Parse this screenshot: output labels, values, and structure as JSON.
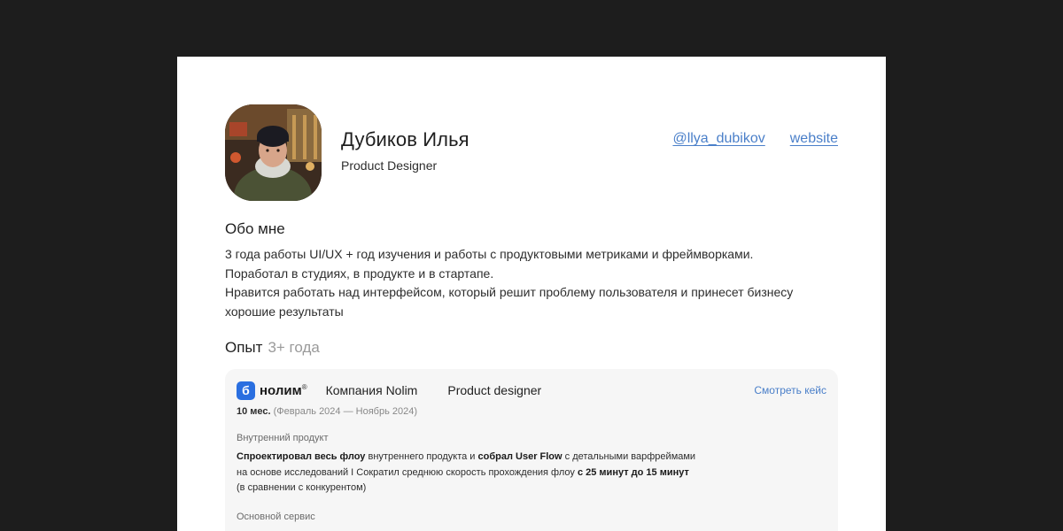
{
  "profile": {
    "name": "Дубиков Илья",
    "role": "Product Designer",
    "links": {
      "telegram": "@llya_dubikov",
      "website": "website"
    }
  },
  "about": {
    "title": "Обо мне",
    "lines": [
      "3 года работы UI/UX + год изучения и работы с продуктовыми метриками и фреймворками.",
      "Поработал в студиях, в продукте и в стартапе.",
      "Нравится работать над интерфейсом, который решит проблему пользователя и принесет бизнесу",
      "хорошие результаты"
    ]
  },
  "experience": {
    "title": "Опыт",
    "years": "3+ года",
    "job": {
      "logo_mark": "б",
      "logo_text": "нолим",
      "logo_reg": "®",
      "company": "Компания Nolim",
      "position": "Product designer",
      "case_link": "Смотреть кейс",
      "duration": "10 мес.",
      "dates": "(Февраль 2024 — Ноябрь 2024)",
      "section1": {
        "label": "Внутренний продукт",
        "line1": {
          "b1": "Спроектировал весь флоу",
          "t1": " внутреннего продукта  и ",
          "b2": "собрал User Flow",
          "t2": " с детальными варфреймами"
        },
        "line2": {
          "t1": "на основе исследований   I   Сократил среднюю скорость прохождения флоу ",
          "b1": "с 25 минут до 15 минут"
        },
        "line3": "(в сравнении с конкурентом)"
      },
      "section2": {
        "label": "Основной сервис"
      }
    }
  },
  "colors": {
    "background": "#1d1d1d",
    "card": "#f6f6f6",
    "link": "#4a7fc9",
    "brand": "#2a6fe0"
  }
}
